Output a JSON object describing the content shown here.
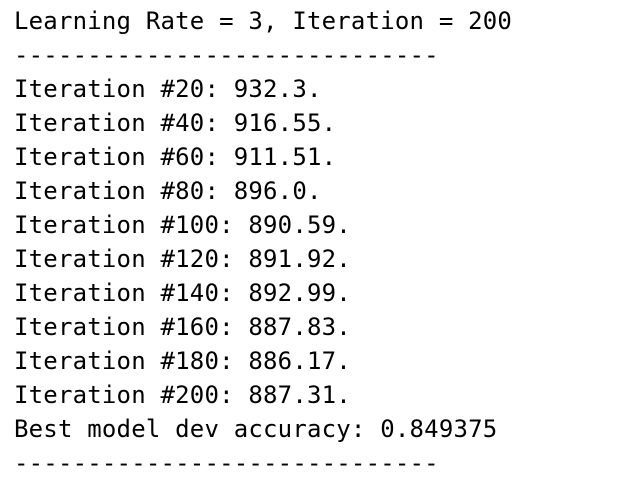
{
  "console": {
    "header": "Learning Rate = 3, Iteration = 200",
    "separator_top": "-----------------------------",
    "iterations": [
      "Iteration #20: 932.3.",
      "Iteration #40: 916.55.",
      "Iteration #60: 911.51.",
      "Iteration #80: 896.0.",
      "Iteration #100: 890.59.",
      "Iteration #120: 891.92.",
      "Iteration #140: 892.99.",
      "Iteration #160: 887.83.",
      "Iteration #180: 886.17.",
      "Iteration #200: 887.31."
    ],
    "best_accuracy": "Best model dev accuracy: 0.849375",
    "separator_bottom": "-----------------------------"
  }
}
